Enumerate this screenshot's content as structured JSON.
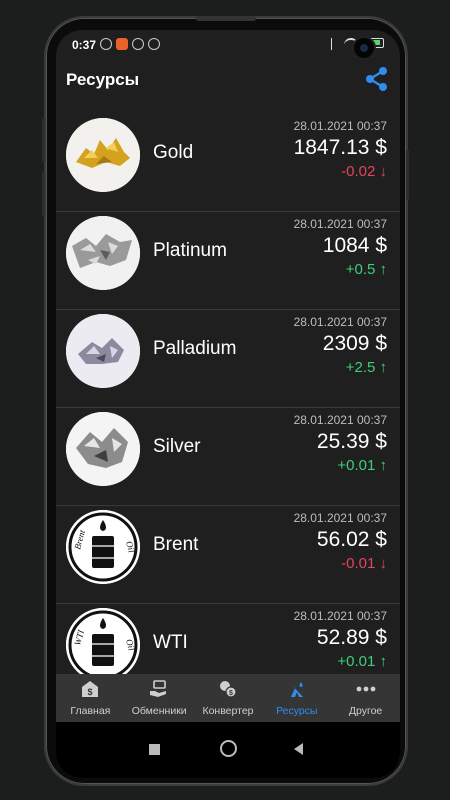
{
  "status_bar": {
    "time": "0:37"
  },
  "header": {
    "title": "Ресурсы"
  },
  "resources": [
    {
      "name": "Gold",
      "date": "28.01.2021 00:37",
      "price": "1847.13 $",
      "change": "-0.02 ↓",
      "direction": "down",
      "icon": "gold-nugget-image"
    },
    {
      "name": "Platinum",
      "date": "28.01.2021 00:37",
      "price": "1084 $",
      "change": "+0.5 ↑",
      "direction": "up",
      "icon": "platinum-nugget-image"
    },
    {
      "name": "Palladium",
      "date": "28.01.2021 00:37",
      "price": "2309 $",
      "change": "+2.5 ↑",
      "direction": "up",
      "icon": "palladium-crystal-image"
    },
    {
      "name": "Silver",
      "date": "28.01.2021 00:37",
      "price": "25.39 $",
      "change": "+0.01 ↑",
      "direction": "up",
      "icon": "silver-crystal-image"
    },
    {
      "name": "Brent",
      "date": "28.01.2021 00:37",
      "price": "56.02 $",
      "change": "-0.01 ↓",
      "direction": "down",
      "icon": "brent-oil-barrel-logo",
      "logo_text": [
        "Brent",
        "Oil"
      ]
    },
    {
      "name": "WTI",
      "date": "28.01.2021 00:37",
      "price": "52.89 $",
      "change": "+0.01 ↑",
      "direction": "up",
      "icon": "wti-oil-barrel-logo",
      "logo_text": [
        "WTI",
        "Oil"
      ]
    }
  ],
  "bottom_nav": [
    {
      "label": "Главная",
      "icon": "home-dollar-icon"
    },
    {
      "label": "Обменники",
      "icon": "exchange-hand-icon"
    },
    {
      "label": "Конвертер",
      "icon": "converter-coins-icon"
    },
    {
      "label": "Ресурсы",
      "icon": "oil-resource-icon",
      "active": true
    },
    {
      "label": "Другое",
      "icon": "more-dots-icon"
    }
  ],
  "colors": {
    "accent": "#2f8df0",
    "up": "#3ecf7a",
    "down": "#e0475a",
    "background": "#1f1f1f"
  }
}
